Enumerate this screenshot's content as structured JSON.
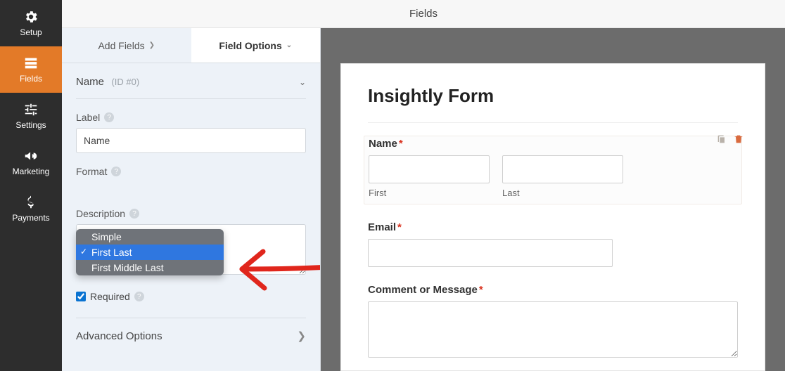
{
  "topbar": {
    "title": "Fields"
  },
  "sidenav": {
    "items": [
      {
        "label": "Setup"
      },
      {
        "label": "Fields"
      },
      {
        "label": "Settings"
      },
      {
        "label": "Marketing"
      },
      {
        "label": "Payments"
      }
    ]
  },
  "tabs": {
    "add": "Add Fields",
    "options": "Field Options"
  },
  "section": {
    "title": "Name",
    "meta": "(ID #0)"
  },
  "labels": {
    "label": "Label",
    "format": "Format",
    "description": "Description",
    "required": "Required",
    "advanced": "Advanced Options"
  },
  "values": {
    "label_input": "Name",
    "required_checked": true
  },
  "format_options": [
    "Simple",
    "First Last",
    "First Middle Last"
  ],
  "format_selected_index": 1,
  "preview": {
    "form_title": "Insightly Form",
    "name_label": "Name",
    "first_sub": "First",
    "last_sub": "Last",
    "email_label": "Email",
    "comment_label": "Comment or Message",
    "asterisk": "*"
  }
}
